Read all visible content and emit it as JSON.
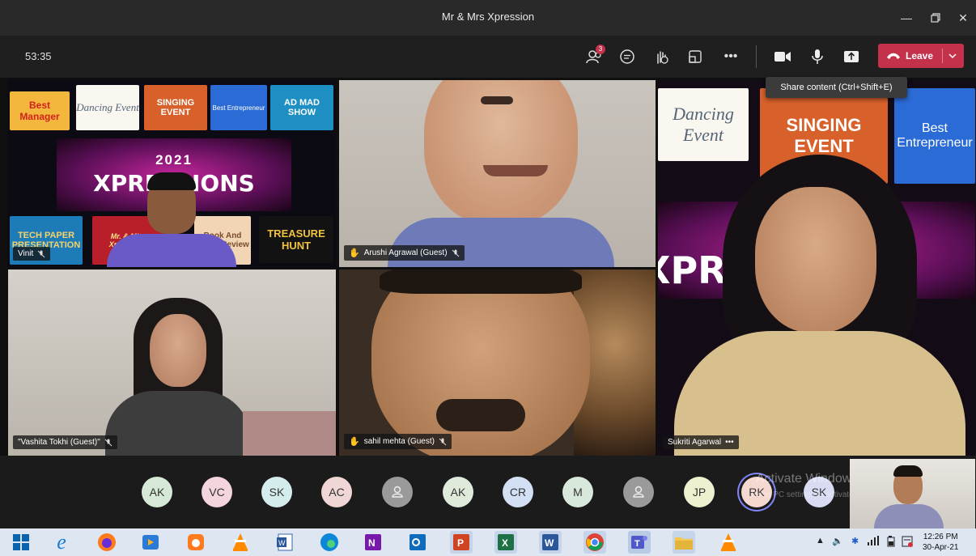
{
  "window": {
    "title": "Mr & Mrs Xpression"
  },
  "toolbar": {
    "timer": "53:35",
    "participants_badge": "3",
    "leave_label": "Leave",
    "tooltip": "Share content (Ctrl+Shift+E)"
  },
  "tiles": [
    {
      "name": "Vinit",
      "muted": true
    },
    {
      "name": "Arushi Agrawal (Guest)",
      "hand_raised": true,
      "muted": true
    },
    {
      "name": "Sukriti Agarwal",
      "more": true
    },
    {
      "name": "\"Vashita Tokhi (Guest)\"",
      "muted": true
    },
    {
      "name": "sahil mehta (Guest)",
      "hand_raised": true,
      "muted": true
    }
  ],
  "background_panels": {
    "best_manager": "Best Manager",
    "dancing": "Dancing Event",
    "singing": "SINGING EVENT",
    "entrepreneur": "Best Entrepreneur",
    "ad": "AD MAD SHOW",
    "year": "2021",
    "xpressions": "XPRESSIONS",
    "tech": "TECH PAPER PRESENTATION",
    "mrmiss": "Mr. & Miss Xpressions",
    "review": "Book And Movie Review",
    "treasure": "TREASURE HUNT",
    "right_dancing": "Dancing Event",
    "right_singing": "SINGING EVENT",
    "right_entre": "Best Entrepreneur",
    "right_xp": "XPRESSIONS"
  },
  "avatars": [
    {
      "initials": "AK",
      "color": "#d6e9d6"
    },
    {
      "initials": "VC",
      "color": "#f4d5dd"
    },
    {
      "initials": "SK",
      "color": "#d5ecec"
    },
    {
      "initials": "AC",
      "color": "#f1d6d6"
    },
    {
      "initials": "",
      "color": "#9a9a9a"
    },
    {
      "initials": "AK",
      "color": "#dfeadb"
    },
    {
      "initials": "CR",
      "color": "#d3dff3"
    },
    {
      "initials": "M",
      "color": "#d8e9dc"
    },
    {
      "initials": "",
      "color": "#9a9a9a"
    },
    {
      "initials": "JP",
      "color": "#eef0cf"
    },
    {
      "initials": "RK",
      "color": "#f5d9d0"
    },
    {
      "initials": "SK",
      "color": "#d9dbf3"
    }
  ],
  "watermark": {
    "line1": "Activate Windows",
    "line2": "Go to PC settings to activate Windows."
  },
  "taskbar": {
    "time": "12:26 PM",
    "date": "30-Apr-21",
    "apps": [
      "start-icon",
      "edge-legacy-icon",
      "firefox-icon",
      "media-player-icon",
      "uc-browser-icon",
      "vlc-icon",
      "word-2007-icon",
      "edge-icon",
      "onenote-icon",
      "outlook-icon",
      "powerpoint-icon",
      "excel-icon",
      "word-icon",
      "chrome-icon",
      "teams-icon",
      "file-explorer-icon",
      "vlc-icon-2"
    ]
  }
}
